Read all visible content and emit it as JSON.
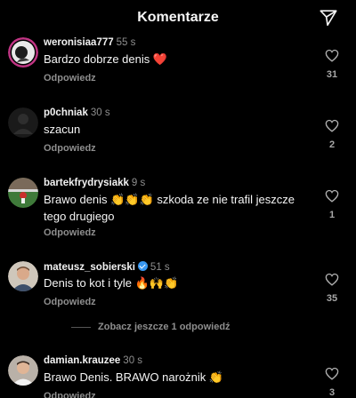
{
  "header": {
    "title": "Komentarze",
    "send_icon": "send-icon"
  },
  "comments": [
    {
      "username": "weronisiaa777",
      "time": "55 s",
      "text": "Bardzo dobrze denis ❤️",
      "reply_label": "Odpowiedz",
      "likes": "31",
      "verified": false
    },
    {
      "username": "p0chniak",
      "time": "30 s",
      "text": "szacun",
      "reply_label": "Odpowiedz",
      "likes": "2",
      "verified": false
    },
    {
      "username": "bartekfrydrysiakk",
      "time": "9 s",
      "text": "Brawo denis 👏👏👏 szkoda ze nie trafil jeszcze tego drugiego",
      "reply_label": "Odpowiedz",
      "likes": "1",
      "verified": false
    },
    {
      "username": "mateusz_sobierski",
      "time": "51 s",
      "text": "Denis to kot i tyle 🔥🙌👏",
      "reply_label": "Odpowiedz",
      "likes": "35",
      "verified": true
    },
    {
      "username": "damian.krauzee",
      "time": "30 s",
      "text": "Brawo Denis. BRAWO narożnik 👏",
      "reply_label": "Odpowiedz",
      "likes": "3",
      "verified": false
    }
  ],
  "more_replies": {
    "label": "Zobacz jeszcze 1 odpowiedź"
  },
  "colors": {
    "background": "#000000",
    "secondary_text": "#8e8e8e",
    "verified": "#3897f0"
  }
}
